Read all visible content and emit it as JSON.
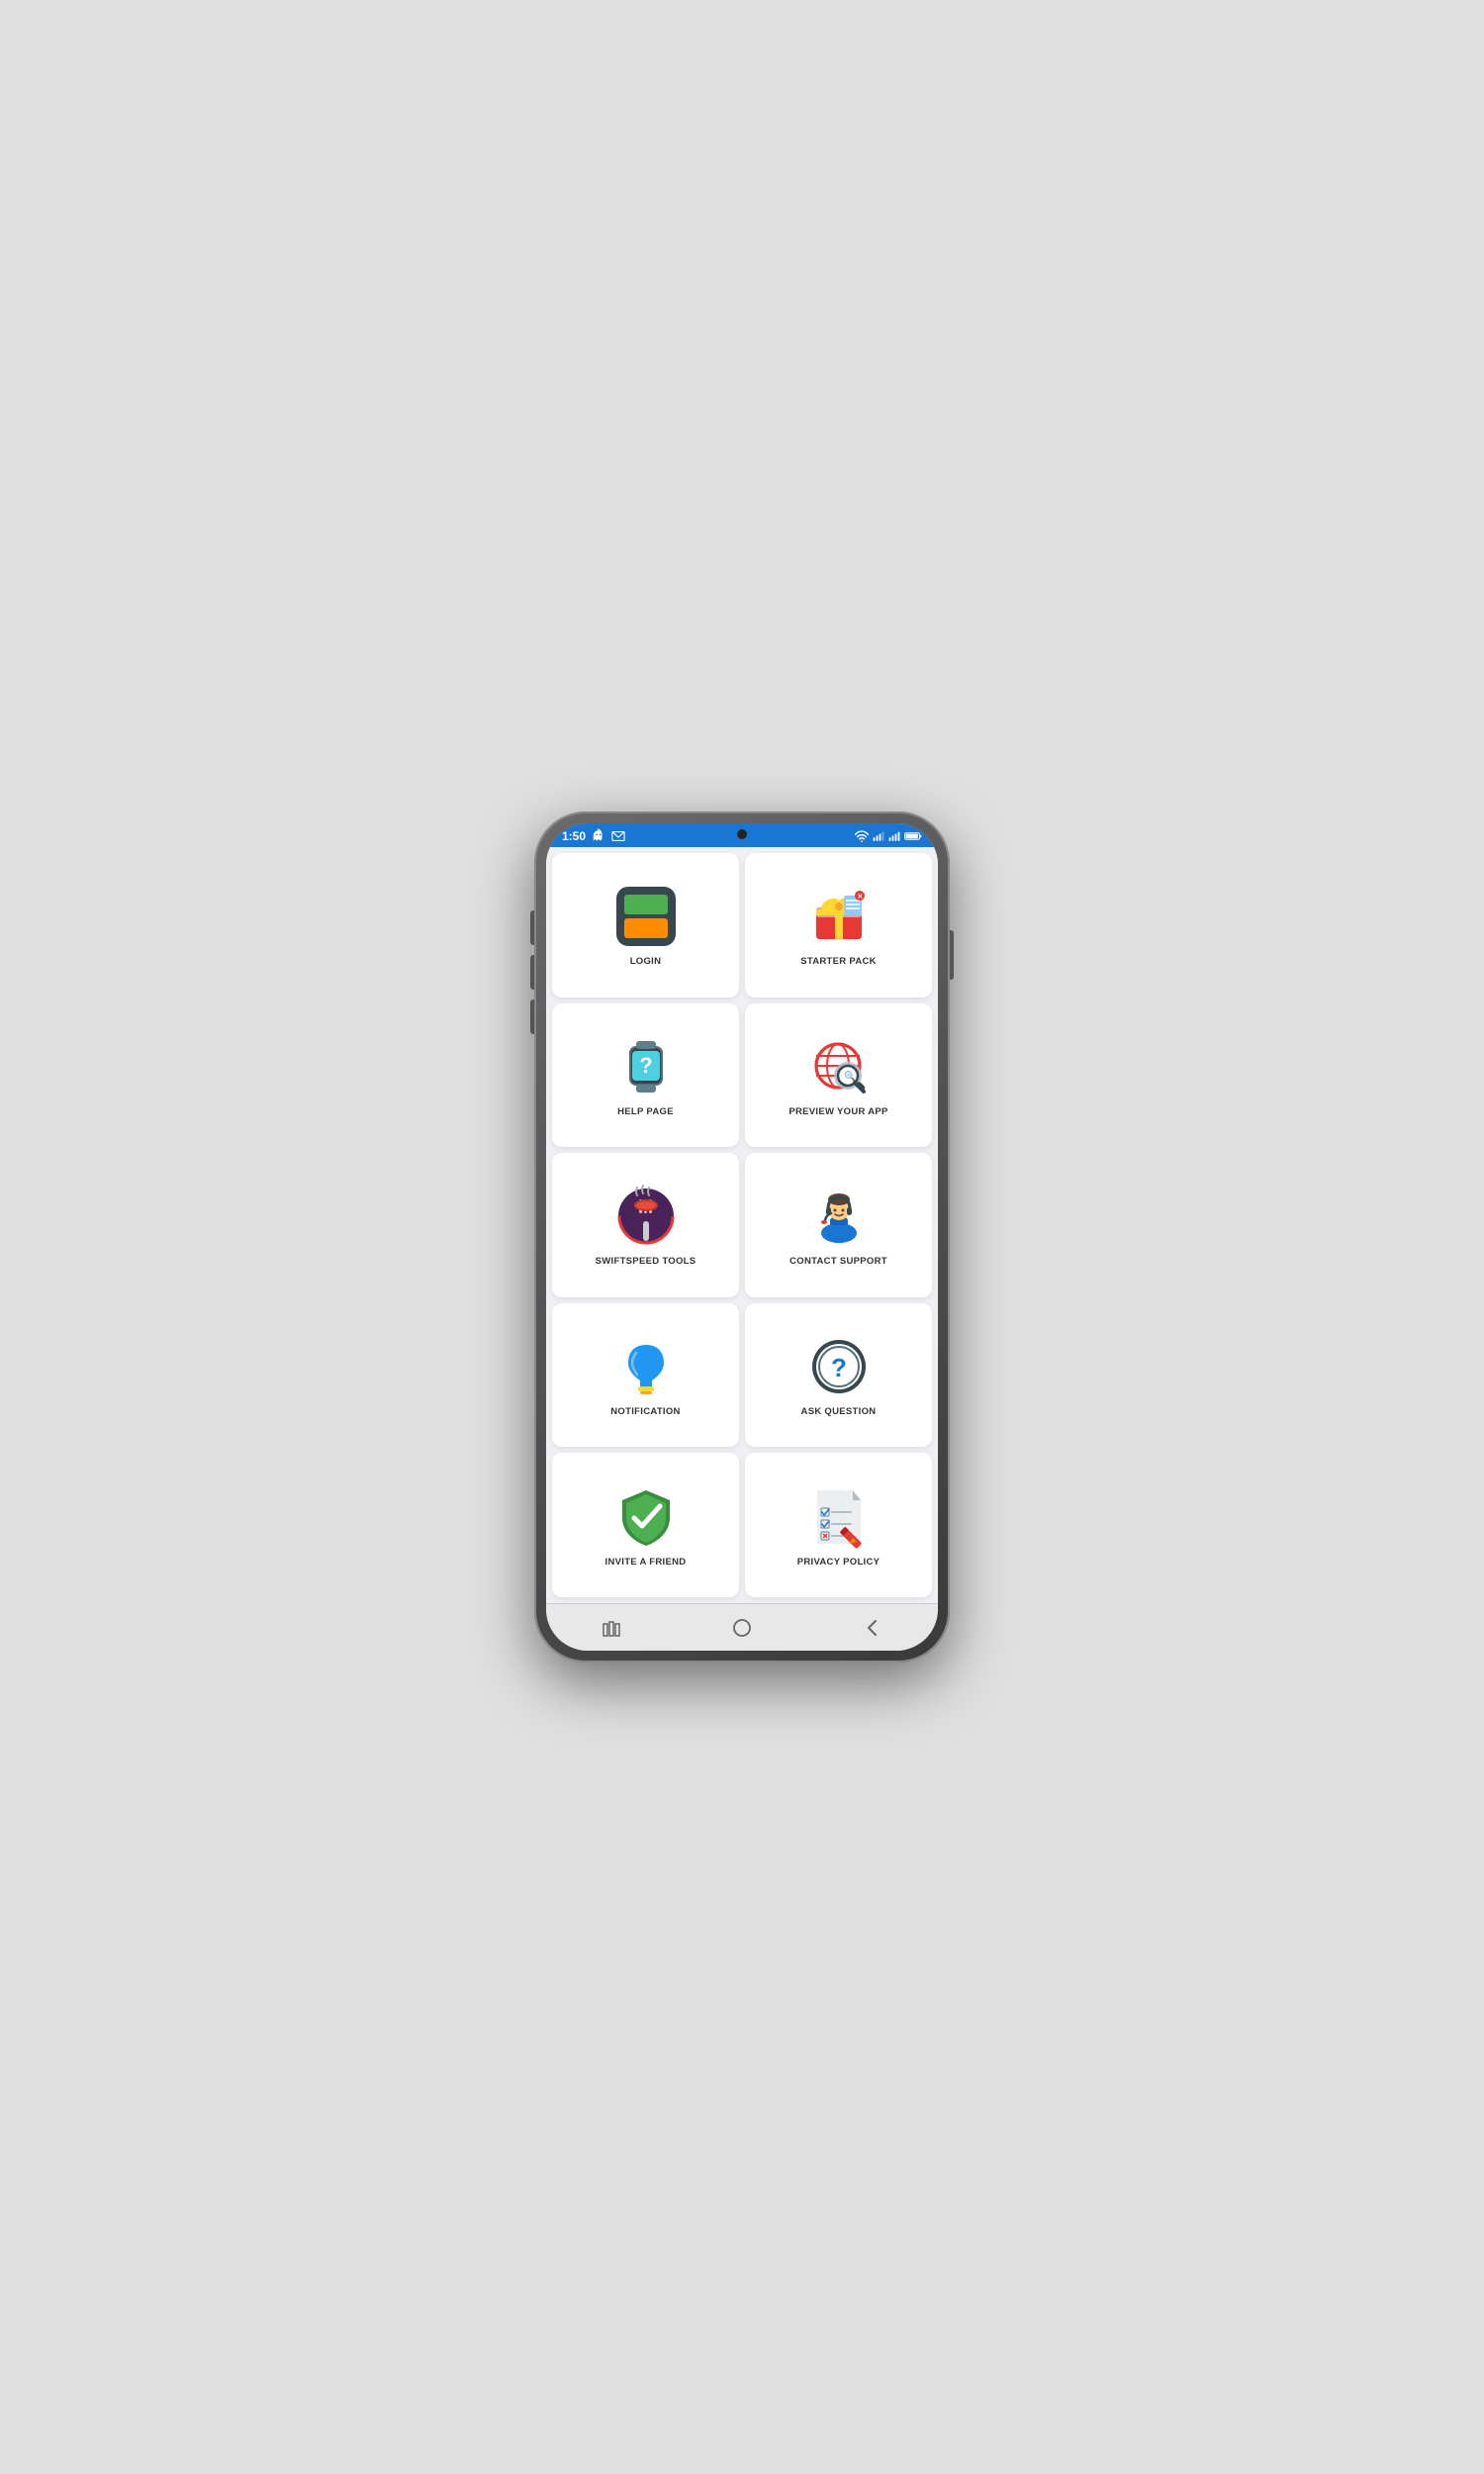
{
  "statusBar": {
    "time": "1:50",
    "icons": [
      "ghost-icon",
      "email-icon",
      "wifi-icon",
      "signal1-icon",
      "signal2-icon",
      "battery-icon"
    ]
  },
  "grid": {
    "items": [
      {
        "id": "login",
        "label": "LOGIN"
      },
      {
        "id": "starter-pack",
        "label": "STARTER PACK"
      },
      {
        "id": "help-page",
        "label": "HELP PAGE"
      },
      {
        "id": "preview-app",
        "label": "PREVIEW YOUR APP"
      },
      {
        "id": "swiftspeed-tools",
        "label": "SWIFTSPEED TOOLS"
      },
      {
        "id": "contact-support",
        "label": "CONTACT SUPPORT"
      },
      {
        "id": "notification",
        "label": "NOTIFICATION"
      },
      {
        "id": "ask-question",
        "label": "ASK QUESTION"
      },
      {
        "id": "invite-friend",
        "label": "INVITE A FRIEND"
      },
      {
        "id": "privacy-policy",
        "label": "PRIVACY POLICY"
      }
    ]
  },
  "navBar": {
    "buttons": [
      "recent-apps-icon",
      "home-icon",
      "back-icon"
    ]
  }
}
